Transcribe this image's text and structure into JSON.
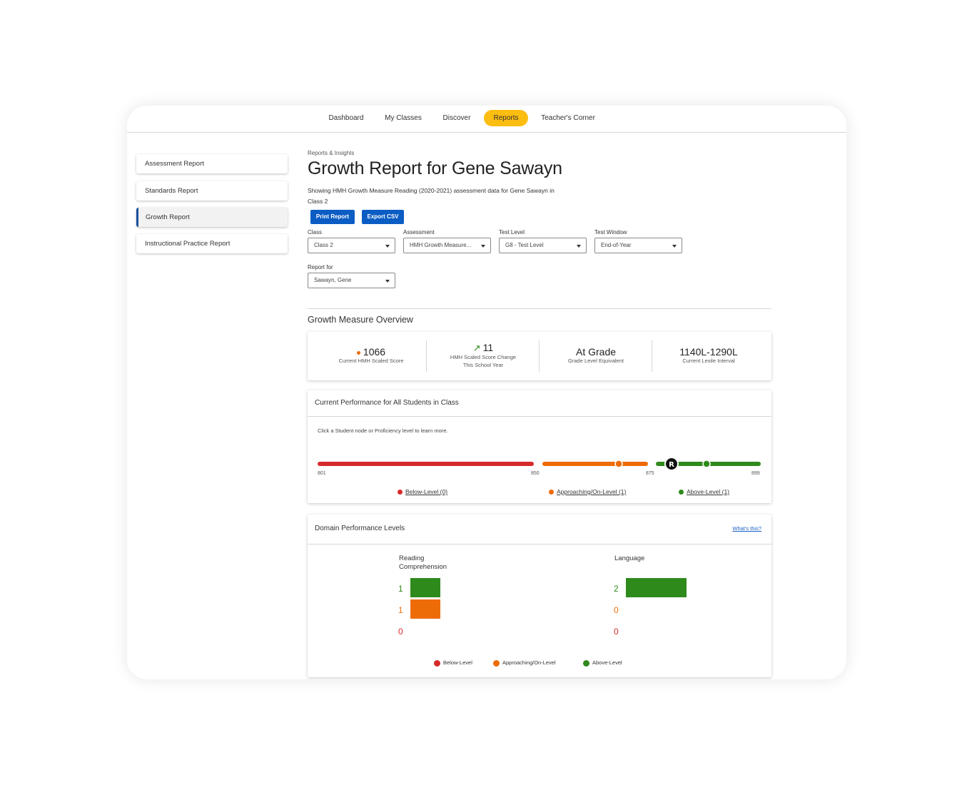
{
  "nav": {
    "items": [
      "Dashboard",
      "My Classes",
      "Discover",
      "Reports",
      "Teacher's Corner"
    ],
    "active": "Reports"
  },
  "sidebar": {
    "items": [
      {
        "label": "Assessment Report"
      },
      {
        "label": "Standards Report"
      },
      {
        "label": "Growth Report",
        "active": true
      },
      {
        "label": "Instructional Practice Report"
      }
    ]
  },
  "header": {
    "breadcrumb": "Reports & Insights",
    "title": "Growth Report for Gene Sawayn",
    "description": "Showing HMH Growth Measure Reading (2020-2021) assessment data for Gene Sawayn in Class 2"
  },
  "actions": {
    "print_label": "Print Report",
    "export_label": "Export CSV"
  },
  "filters": {
    "class": {
      "label": "Class",
      "value": "Class 2"
    },
    "assessment": {
      "label": "Assessment",
      "value": "HMH Growth Measure..."
    },
    "test_level": {
      "label": "Test Level",
      "value": "G8 - Test Level"
    },
    "test_window": {
      "label": "Test Window",
      "value": "End-of-Year"
    },
    "report_for": {
      "label": "Report for",
      "value": "Sawayn, Gene"
    }
  },
  "overview": {
    "title": "Growth Measure Overview",
    "scaled_score": {
      "value": "1066",
      "label": "Current HMH Scaled Score"
    },
    "score_change": {
      "value": "11",
      "label_line1": "HMH Scaled Score Change",
      "label_line2": "This School Year"
    },
    "grade_level": {
      "value": "At Grade",
      "label": "Grade Level Equivalent"
    },
    "lexile": {
      "value": "1140L-1290L",
      "label": "Current Lexile Interval"
    }
  },
  "performance": {
    "title": "Current Performance for All Students in Class",
    "hint": "Click a Student node or Proficiency level to learn more.",
    "ticks": [
      "801",
      "850",
      "875",
      "899"
    ],
    "scale": {
      "min": 801,
      "below_end": 850,
      "approaching_end": 875,
      "max": 899
    },
    "legend": {
      "below": "Below-Level (0)",
      "approaching": "Approaching/On-Level (1)",
      "above": "Above-Level (1)"
    }
  },
  "domain": {
    "title": "Domain Performance Levels",
    "whats_this": "What's this?",
    "reading": {
      "label_line1": "Reading",
      "label_line2": "Comprehension",
      "counts": {
        "above": "1",
        "approaching": "1",
        "below": "0"
      }
    },
    "language": {
      "label": "Language",
      "counts": {
        "above": "2",
        "approaching": "0",
        "below": "0"
      }
    },
    "legend": {
      "below": "Below-Level",
      "approaching": "Approaching/On-Level",
      "above": "Above-Level"
    }
  },
  "colors": {
    "accent": "#fbbd10",
    "primary": "#0b5dc4",
    "below": "#d62a2a",
    "approaching": "#ee6c07",
    "above": "#2f8a1c"
  }
}
